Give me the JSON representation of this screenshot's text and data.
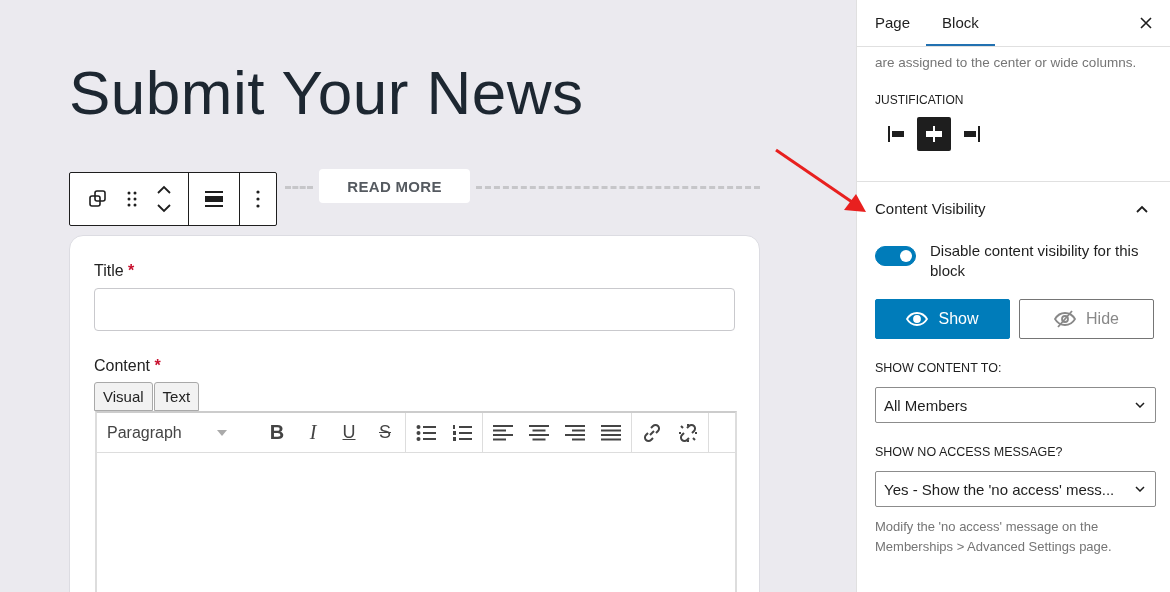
{
  "page_title": "Submit Your News",
  "read_more": "READ MORE",
  "form": {
    "fields": [
      {
        "kind": "text",
        "label": "Title",
        "required_mark": "*"
      },
      {
        "kind": "editor",
        "label": "Content",
        "required_mark": "*"
      }
    ],
    "editor_tabs": [
      "Visual",
      "Text"
    ],
    "format_select": "Paragraph",
    "format_buttons": [
      {
        "kind": "bold",
        "glyph": "B"
      },
      {
        "kind": "italic",
        "glyph": "I"
      },
      {
        "kind": "underline",
        "glyph": "U"
      },
      {
        "kind": "strike",
        "glyph": "S"
      }
    ]
  },
  "sidebar": {
    "tabs": [
      {
        "label": "Page",
        "selected": false
      },
      {
        "label": "Block",
        "selected": true
      }
    ],
    "cut_text": "are assigned to the center or wide columns.",
    "justification": {
      "label": "JUSTIFICATION",
      "options": [
        {
          "kind": "left",
          "selected": false
        },
        {
          "kind": "center",
          "selected": true
        },
        {
          "kind": "right",
          "selected": false
        }
      ]
    },
    "section": {
      "title": "Content Visibility",
      "expanded": true,
      "toggle": {
        "label": "Disable content visibility for this block",
        "on": true
      },
      "visibility_buttons": [
        {
          "kind": "show",
          "label": "Show",
          "selected": true
        },
        {
          "kind": "hide",
          "label": "Hide",
          "selected": false
        }
      ],
      "selects": [
        {
          "label": "SHOW CONTENT TO:",
          "value": "All Members"
        },
        {
          "label": "SHOW NO ACCESS MESSAGE?",
          "value": "Yes - Show the 'no access' mess..."
        }
      ],
      "help": "Modify the 'no access' message on the Memberships > Advanced Settings page."
    }
  }
}
